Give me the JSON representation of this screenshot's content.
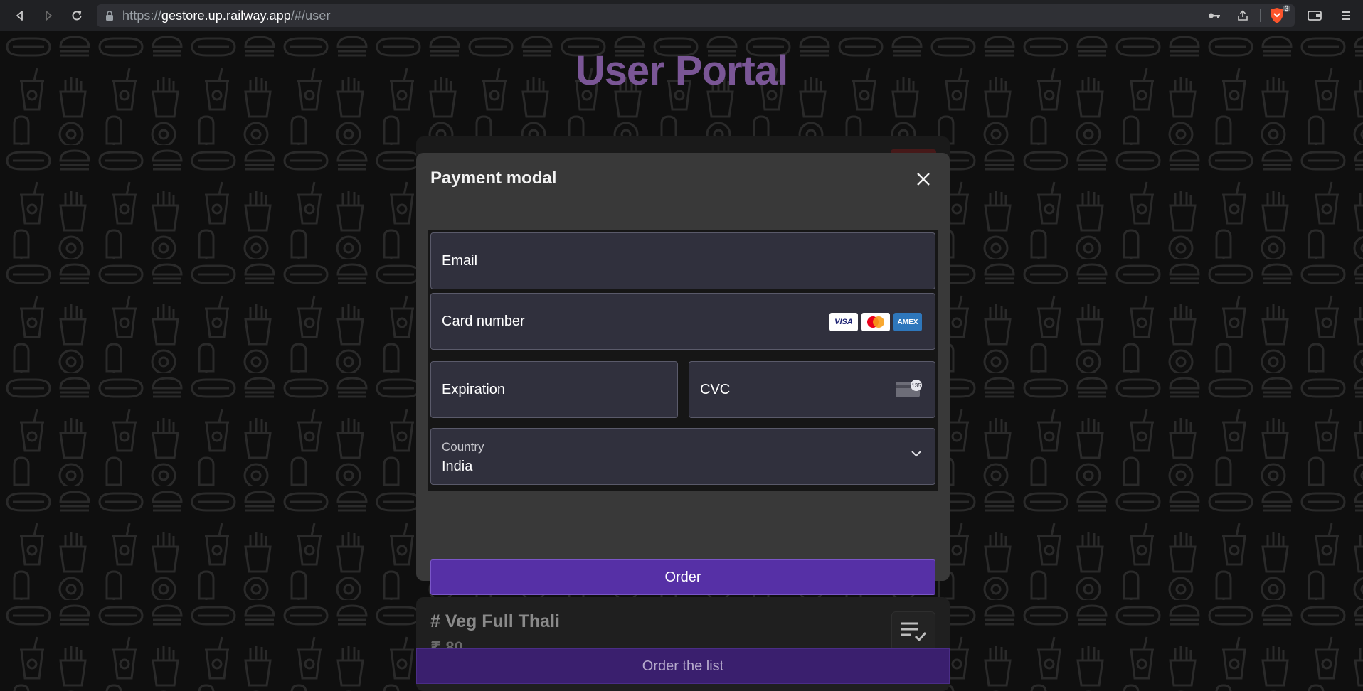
{
  "browser": {
    "url_scheme": "https://",
    "url_host": "gestore.up.railway.app",
    "url_path": "/#/user",
    "shields_badge": "3"
  },
  "page": {
    "title": "User Portal"
  },
  "modal": {
    "title": "Payment modal",
    "fields": {
      "email_label": "Email",
      "card_number_label": "Card number",
      "expiration_label": "Expiration",
      "cvc_label": "CVC",
      "cvc_icon_text": "135",
      "country_label": "Country",
      "country_value": "India"
    },
    "card_brands": [
      "VISA",
      "mastercard",
      "AMEX"
    ],
    "order_button": "Order"
  },
  "items": [
    {
      "title": "# Veg Full Thali",
      "price": "₹ 80"
    }
  ],
  "footer": {
    "order_list_button": "Order the list"
  },
  "colors": {
    "title_purple": "#7a5696",
    "order_button": "#5630a6",
    "order_list_bar": "#3a1f6e"
  }
}
